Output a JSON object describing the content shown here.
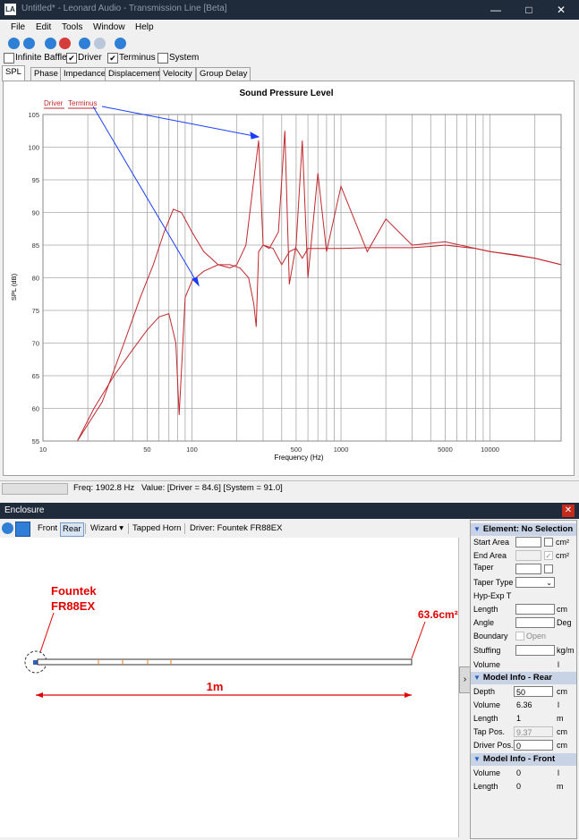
{
  "window": {
    "title": "Untitled* - Leonard Audio - Transmission Line [Beta]",
    "app_icon_text": "LA",
    "buttons": {
      "minimize": "—",
      "maximize": "□",
      "close": "✕"
    }
  },
  "menu": [
    "File",
    "Edit",
    "Tools",
    "Window",
    "Help"
  ],
  "checkboxes": [
    {
      "label": "Infinite Baffle",
      "checked": false
    },
    {
      "label": "Driver",
      "checked": true
    },
    {
      "label": "Terminus",
      "checked": true
    },
    {
      "label": "System",
      "checked": false
    }
  ],
  "tabs": [
    "SPL",
    "Phase",
    "Impedance",
    "Displacement",
    "Velocity",
    "Group Delay"
  ],
  "active_tab": "SPL",
  "chart_data": {
    "type": "line",
    "title": "Sound Pressure Level",
    "xlabel": "Frequency (Hz)",
    "ylabel": "SPL (dB)",
    "x_scale": "log",
    "xlim": [
      10,
      30000
    ],
    "ylim": [
      55,
      105
    ],
    "xticks": [
      10,
      50,
      100,
      500,
      1000,
      5000,
      10000
    ],
    "xtick_labels": [
      "10",
      "50",
      "100",
      "500",
      "1000",
      "5000",
      "10000"
    ],
    "yticks": [
      55,
      60,
      65,
      70,
      75,
      80,
      85,
      90,
      95,
      100,
      105
    ],
    "grid": true,
    "legend": [
      "Driver",
      "Terminus"
    ],
    "legend_position": "top-left",
    "series": [
      {
        "name": "Driver",
        "color": "#c0282d",
        "x": [
          17,
          22,
          30,
          40,
          50,
          60,
          70,
          78,
          82,
          86,
          90,
          100,
          120,
          150,
          180,
          210,
          240,
          260,
          270,
          280,
          300,
          350,
          400,
          450,
          500,
          550,
          600,
          700,
          800,
          1000,
          1500,
          2000,
          3000,
          4000,
          5000,
          6000,
          8000,
          10000,
          15000,
          20000,
          30000
        ],
        "y": [
          55,
          60,
          65,
          69,
          72,
          74,
          74.5,
          70,
          59,
          68,
          77,
          79.5,
          81,
          82,
          82,
          81.5,
          80,
          76,
          72.5,
          84,
          85,
          84.5,
          82,
          84,
          84.5,
          83,
          84.5,
          84.5,
          84.5,
          84.5,
          84.6,
          84.6,
          84.6,
          84.8,
          85,
          84.8,
          84.5,
          84,
          83.5,
          83,
          82
        ]
      },
      {
        "name": "Terminus",
        "color": "#c0282d",
        "x": [
          17,
          25,
          35,
          45,
          55,
          65,
          75,
          85,
          100,
          120,
          150,
          180,
          200,
          230,
          260,
          280,
          300,
          330,
          380,
          420,
          450,
          500,
          550,
          600,
          700,
          800,
          1000,
          1500,
          2000,
          3000,
          5000,
          10000,
          20000,
          30000
        ],
        "y": [
          55,
          61,
          70,
          77,
          82,
          87,
          90.5,
          90,
          87,
          84,
          82,
          81.5,
          82,
          85,
          95,
          101,
          85,
          84.5,
          87,
          102.5,
          79,
          85,
          101,
          80,
          96,
          84,
          94,
          84,
          89,
          85,
          85.5,
          84,
          83,
          82
        ]
      }
    ],
    "status": {
      "freq": "Freq: 1902.8 Hz",
      "value": "Value: [Driver = 84.6]  [System = 91.0]"
    }
  },
  "enclosure": {
    "panel_title": "Enclosure",
    "toolbar": {
      "front": "Front",
      "rear": "Rear",
      "wizard": "Wizard ▾",
      "type": "Tapped Horn",
      "driver": "Driver: Fountek FR88EX"
    },
    "annotations": {
      "driver_name_1": "Fountek",
      "driver_name_2": "FR88EX",
      "area": "63.6cm²",
      "length": "1m"
    },
    "element": {
      "header": "Element: No Selection",
      "start_area": "Start Area",
      "end_area": "End Area",
      "taper": "Taper",
      "taper_type": "Taper Type",
      "hyp_exp": "Hyp-Exp T",
      "length": "Length",
      "angle": "Angle",
      "boundary": "Boundary",
      "open": "Open",
      "stuffing": "Stuffing",
      "volume": "Volume",
      "unit_cm2": "cm²",
      "unit_cm": "cm",
      "unit_deg": "Deg",
      "unit_kgm": "kg/m",
      "unit_l": "l"
    },
    "model_rear": {
      "header": "Model Info - Rear",
      "depth_label": "Depth",
      "depth_value": "50",
      "depth_unit": "cm",
      "volume_label": "Volume",
      "volume_value": "6.36",
      "volume_unit": "l",
      "length_label": "Length",
      "length_value": "1",
      "length_unit": "m",
      "tap_label": "Tap Pos.",
      "tap_value": "9.37",
      "tap_unit": "cm",
      "drvpos_label": "Driver Pos.",
      "drvpos_value": "0",
      "drvpos_unit": "cm"
    },
    "model_front": {
      "header": "Model Info - Front",
      "volume_label": "Volume",
      "volume_value": "0",
      "volume_unit": "l",
      "length_label": "Length",
      "length_value": "0",
      "length_unit": "m"
    }
  },
  "colors": {
    "accent": "#1f5fbf",
    "titlebar": "#1f2a3b",
    "curve": "#c0282d",
    "annotation": "#e00000",
    "arrow": "#1a3dff"
  }
}
